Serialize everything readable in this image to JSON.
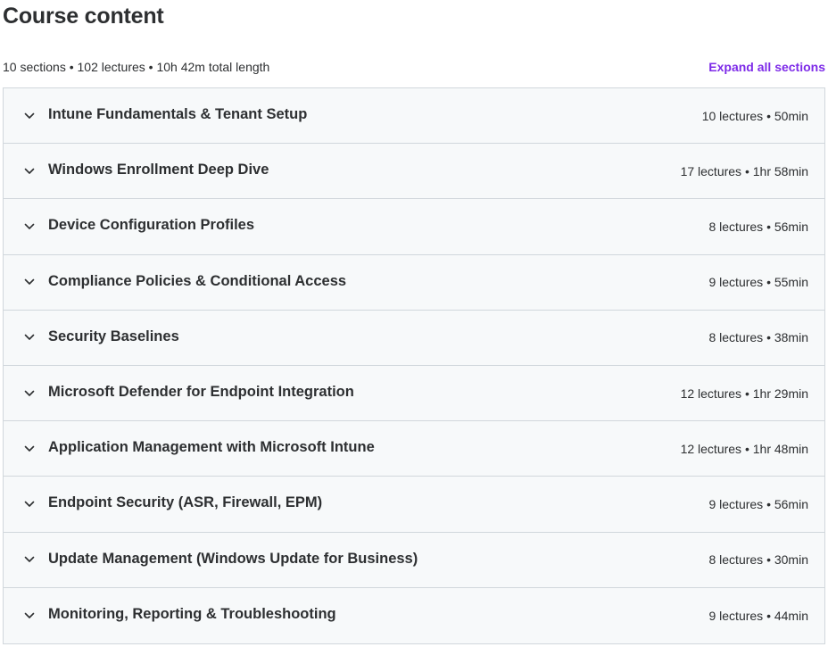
{
  "header": {
    "title": "Course content",
    "summary": "10 sections • 102 lectures • 10h 42m total length",
    "expand_all_label": "Expand all sections"
  },
  "colors": {
    "link": "#7d2ae8",
    "row_bg": "#f7f9fa",
    "border": "#d1d7dc",
    "text": "#2d2f31"
  },
  "sections": [
    {
      "title": "Intune Fundamentals & Tenant Setup",
      "meta": "10 lectures • 50min"
    },
    {
      "title": "Windows Enrollment Deep Dive",
      "meta": "17 lectures • 1hr 58min"
    },
    {
      "title": "Device Configuration Profiles",
      "meta": "8 lectures • 56min"
    },
    {
      "title": "Compliance Policies & Conditional Access",
      "meta": "9 lectures • 55min"
    },
    {
      "title": "Security Baselines",
      "meta": "8 lectures • 38min"
    },
    {
      "title": "Microsoft Defender for Endpoint Integration",
      "meta": "12 lectures • 1hr 29min"
    },
    {
      "title": "Application Management with Microsoft Intune",
      "meta": "12 lectures • 1hr 48min"
    },
    {
      "title": "Endpoint Security (ASR, Firewall, EPM)",
      "meta": "9 lectures • 56min"
    },
    {
      "title": "Update Management (Windows Update for Business)",
      "meta": "8 lectures • 30min"
    },
    {
      "title": "Monitoring, Reporting & Troubleshooting",
      "meta": "9 lectures • 44min"
    }
  ]
}
